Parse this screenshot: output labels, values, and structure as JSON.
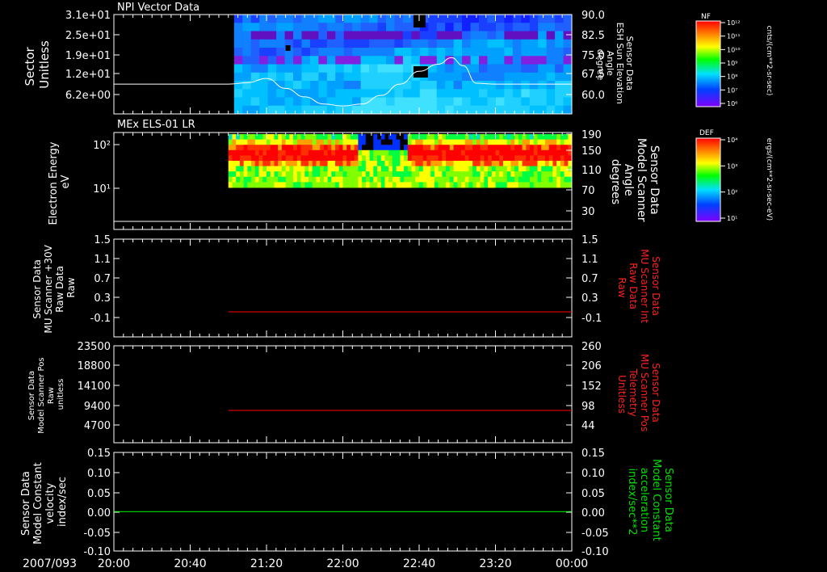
{
  "chart_data": [
    {
      "type": "heatmap",
      "title": "NPI Vector Data",
      "ylabel_left": [
        "Sector",
        "Unitless"
      ],
      "yticks_left": [
        "3.1e+01",
        "2.5e+01",
        "1.9e+01",
        "1.2e+01",
        "6.2e+00"
      ],
      "ylabel_right": [
        "Sensor Data",
        "ESH Sun Elevation",
        "Angle",
        "degree"
      ],
      "yticks_right": [
        "90.0",
        "82.5",
        "75.0",
        "67.5",
        "60.0"
      ],
      "ylim_right": [
        55,
        90
      ],
      "colorbar": {
        "label": "NF",
        "units": "cnts/(cm**2-sr-sec)",
        "ticks": [
          "10¹²",
          "10¹¹",
          "10¹⁰",
          "10⁹",
          "10⁸",
          "10⁷",
          "10⁶"
        ]
      },
      "line_series": {
        "color": "#ffffff",
        "x": [
          "20:00",
          "21:00",
          "21:10",
          "21:20",
          "21:30",
          "21:40",
          "21:50",
          "22:00",
          "22:10",
          "22:20",
          "22:30",
          "22:40",
          "22:50",
          "22:57",
          "23:03",
          "23:10",
          "23:20",
          "23:40",
          "00:00"
        ],
        "y": [
          65.5,
          65.5,
          66.0,
          67.5,
          64.0,
          61.0,
          58.5,
          57.8,
          58.5,
          61.5,
          65.5,
          70.0,
          72.5,
          74.8,
          72.0,
          65.8,
          65.5,
          65.5,
          65.5
        ]
      }
    },
    {
      "type": "heatmap",
      "title": "MEx ELS-01 LR",
      "ylabel_left": [
        "Electron Energy",
        "eV"
      ],
      "yticks_left": [
        "10²",
        "10¹"
      ],
      "ylabel_right": [
        "Sensor Data",
        "Model Scanner",
        "Angle",
        "degrees"
      ],
      "yticks_right": [
        "190",
        "150",
        "110",
        "70",
        "30"
      ],
      "ylim_right": [
        0,
        190
      ],
      "colorbar": {
        "label": "DEF",
        "units": "ergs/(cm**2-sr-sec-eV)",
        "ticks": [
          "10⁴",
          "10³",
          "10²",
          "10¹"
        ]
      },
      "line_series": {
        "color": "#ffffff",
        "x": [
          "20:00",
          "00:00"
        ],
        "y": [
          10,
          10
        ]
      }
    },
    {
      "type": "line",
      "ylabel_left": [
        "Sensor Data",
        "MU Scanner +30V",
        "Raw Data",
        "Raw"
      ],
      "yticks_left": [
        "1.5",
        "1.1",
        "0.7",
        "0.3",
        "-0.1"
      ],
      "ylabel_right": [
        "Sensor Data",
        "MU Scanner Int",
        "Raw Data",
        "Raw"
      ],
      "yticks_right": [
        "1.5",
        "1.1",
        "0.7",
        "0.3",
        "-0.1"
      ],
      "ylim": [
        -0.3,
        1.5
      ],
      "series": [
        {
          "color": "#ff0000",
          "x": [
            "21:00",
            "00:00"
          ],
          "y": [
            0.0,
            0.0
          ]
        }
      ]
    },
    {
      "type": "line",
      "ylabel_left": [
        "Sensor Data",
        "Model Scanner Pos",
        "Raw",
        "unitless"
      ],
      "yticks_left": [
        "23500",
        "18800",
        "14100",
        "9400",
        "4700"
      ],
      "ylabel_right": [
        "Sensor Data",
        "MU Scanner Pos",
        "Telemetry",
        "Unitless"
      ],
      "yticks_right": [
        "260",
        "206",
        "152",
        "98",
        "44"
      ],
      "ylim_right": [
        -10,
        260
      ],
      "series": [
        {
          "color": "#ff0000",
          "x": [
            "21:00",
            "00:00"
          ],
          "y": [
            80,
            80
          ]
        }
      ]
    },
    {
      "type": "line",
      "ylabel_left": [
        "Sensor Data",
        "Model Constant",
        "velocity",
        "index/sec"
      ],
      "yticks_left": [
        "0.15",
        "0.10",
        "0.05",
        "0.00",
        "-0.05",
        "-0.10"
      ],
      "ylabel_right": [
        "Sensor Data",
        "Model Constant",
        "acceleration",
        "index/sec**2"
      ],
      "yticks_right": [
        "0.15",
        "0.10",
        "0.05",
        "0.00",
        "-0.05",
        "-0.10"
      ],
      "ylim": [
        -0.1,
        0.15
      ],
      "series": [
        {
          "color": "#00ff00",
          "x": [
            "20:00",
            "00:00"
          ],
          "y": [
            0.0,
            0.0
          ]
        }
      ]
    }
  ],
  "x_axis": {
    "date_label": "2007/093",
    "tick_labels": [
      "20:00",
      "20:40",
      "21:20",
      "22:00",
      "22:40",
      "23:20",
      "00:00"
    ],
    "start": "20:00",
    "end": "00:00"
  },
  "colors": {
    "background": "#000000",
    "axes": "#ffffff",
    "red_label": "#ff2020",
    "green_label": "#00e000"
  }
}
